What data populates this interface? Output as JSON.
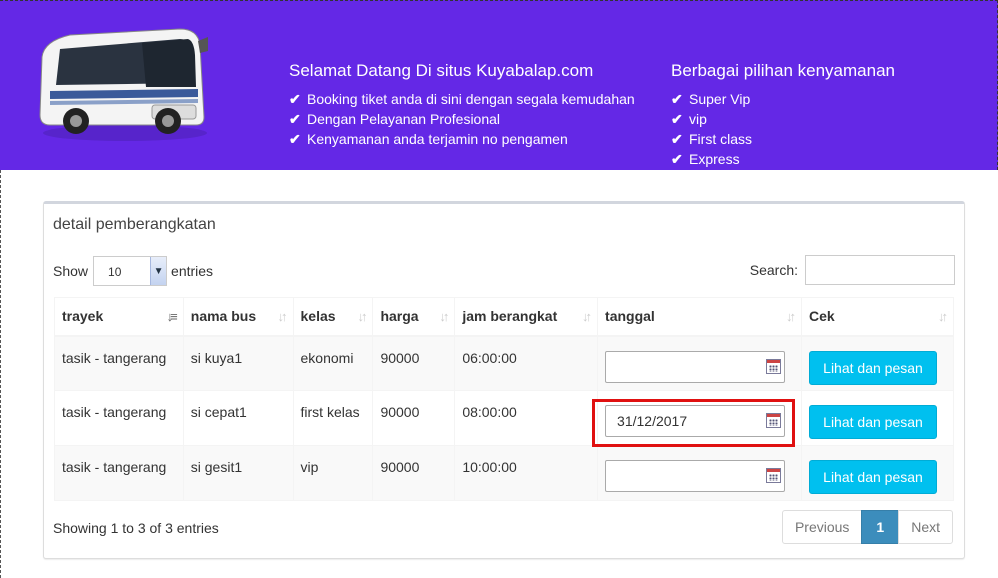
{
  "header": {
    "col1": {
      "title": "Selamat Datang Di situs Kuyabalap.com",
      "items": [
        "Booking tiket anda di sini dengan segala kemudahan",
        "Dengan Pelayanan Profesional",
        "Kenyamanan anda terjamin no pengamen"
      ]
    },
    "col2": {
      "title": "Berbagai pilihan kenyamanan",
      "items": [
        "Super Vip",
        "vip",
        "First class",
        "Express"
      ]
    },
    "check_glyph": "✔",
    "bg_color": "#6428e6"
  },
  "panel": {
    "title": "detail pemberangkatan",
    "show_label": "Show",
    "entries_value": "10",
    "entries_label": "entries",
    "search_label": "Search:",
    "search_value": ""
  },
  "table": {
    "columns": [
      "trayek",
      "nama bus",
      "kelas",
      "harga",
      "jam berangkat",
      "tanggal",
      "Cek"
    ],
    "rows": [
      {
        "trayek": "tasik - tangerang",
        "nama_bus": "si kuya1",
        "kelas": "ekonomi",
        "harga": "90000",
        "jam": "06:00:00",
        "tanggal": "",
        "action": "Lihat dan pesan"
      },
      {
        "trayek": "tasik - tangerang",
        "nama_bus": "si cepat1",
        "kelas": "first kelas",
        "harga": "90000",
        "jam": "08:00:00",
        "tanggal": "31/12/2017",
        "action": "Lihat dan pesan"
      },
      {
        "trayek": "tasik - tangerang",
        "nama_bus": "si gesit1",
        "kelas": "vip",
        "harga": "90000",
        "jam": "10:00:00",
        "tanggal": "",
        "action": "Lihat dan pesan"
      }
    ]
  },
  "footer": {
    "info": "Showing 1 to 3 of 3 entries",
    "previous": "Previous",
    "page": "1",
    "next": "Next"
  },
  "colors": {
    "button": "#00c0ef",
    "pager_active": "#3c8dbc",
    "highlight": "#e01010"
  }
}
